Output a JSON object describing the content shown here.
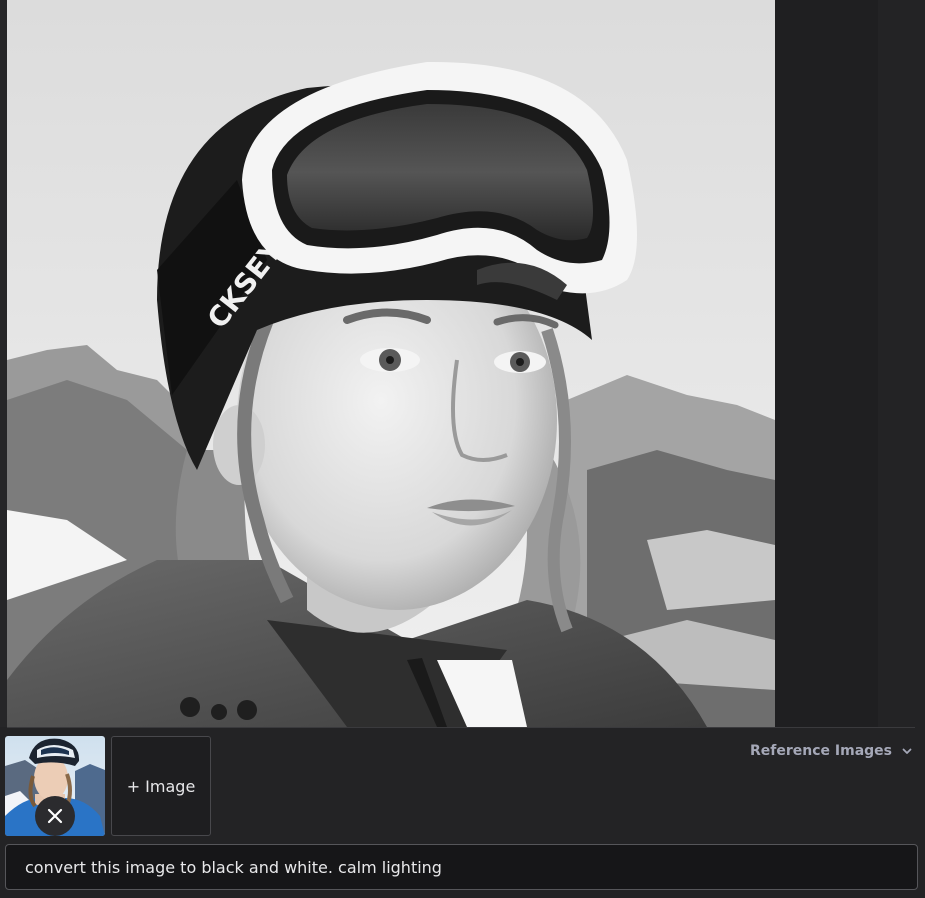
{
  "main_image": {
    "headband_text": "CKSEY4"
  },
  "reference": {
    "toggle_label": "Reference Images",
    "add_image_label": "+ Image"
  },
  "prompt": {
    "value": "convert this image to black and white. calm lighting"
  },
  "colors": {
    "background": "#232325",
    "accent_text": "#a5a8b8"
  }
}
